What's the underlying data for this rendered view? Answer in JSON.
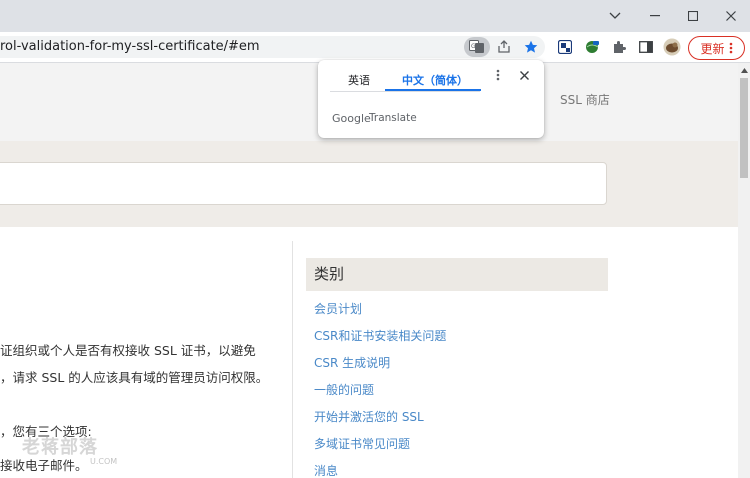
{
  "browser": {
    "url": "rol-validation-for-my-ssl-certificate/#em",
    "update_label": "更新",
    "window_controls": [
      "chevron-down-icon",
      "minimize-icon",
      "maximize-icon",
      "close-icon"
    ]
  },
  "translate_popup": {
    "tabs": [
      {
        "label": "英语",
        "active": false
      },
      {
        "label": "中文（简体）",
        "active": true
      }
    ],
    "brand_google": "Google",
    "brand_translate": "Translate",
    "accent_color": "#1a73e8"
  },
  "site": {
    "nav_ssl_store": "SSL 商店",
    "body_lines": [
      "证组织或个人是否有权接收 SSL 证书，以避免",
      "，请求 SSL 的人应该具有域的管理员访问权限。",
      "，您有三个选项:",
      "接收电子邮件。"
    ],
    "categories_title": "类别",
    "categories": [
      "会员计划",
      "CSR和证书安装相关问题",
      "CSR 生成说明",
      "一般的问题",
      "开始并激活您的 SSL",
      "多域证书常见问题",
      "消息"
    ],
    "link_color": "#4a89c8"
  },
  "watermark": {
    "text": "老蒋部落",
    "sub": "U.COM"
  }
}
